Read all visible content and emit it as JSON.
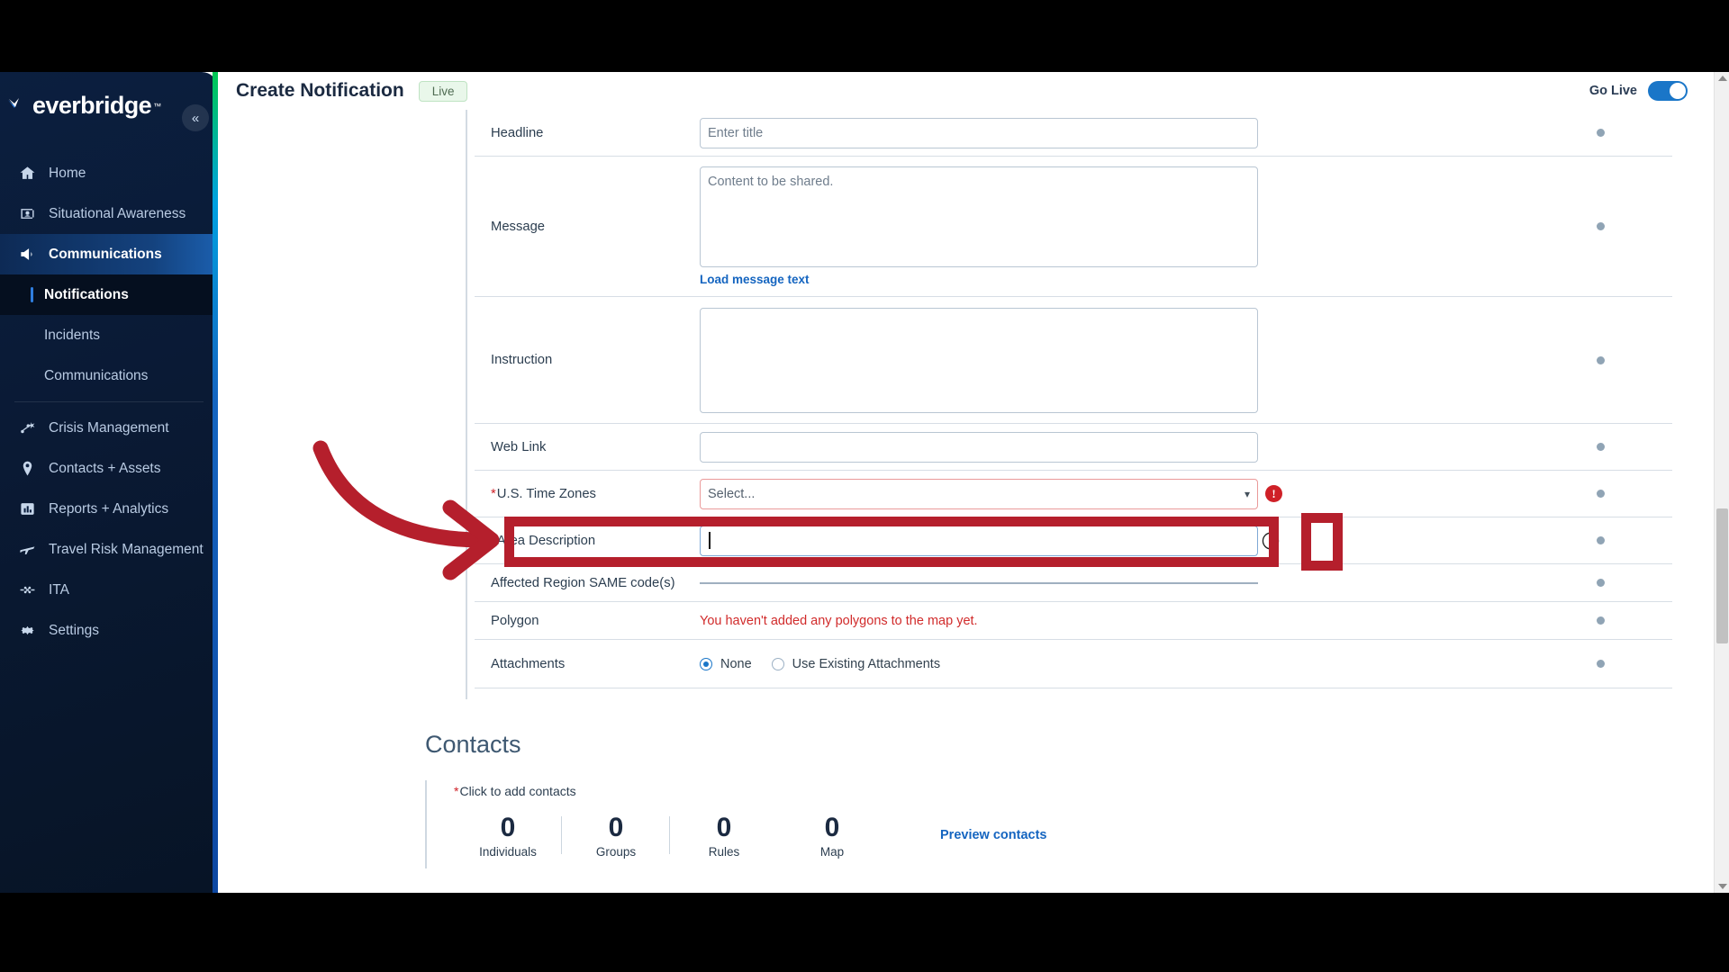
{
  "brand": {
    "name": "everbridge",
    "tm": "™",
    "accent": "#1a76c8"
  },
  "sidebar": {
    "collapse_icon": "chevron-double-left-icon",
    "items": [
      {
        "label": "Home",
        "icon": "home-icon",
        "active": false
      },
      {
        "label": "Situational Awareness",
        "icon": "situational-awareness-icon",
        "active": false
      },
      {
        "label": "Communications",
        "icon": "megaphone-icon",
        "active": true
      }
    ],
    "sub_items": [
      {
        "label": "Notifications",
        "current": true
      },
      {
        "label": "Incidents",
        "current": false
      },
      {
        "label": "Communications",
        "current": false
      }
    ],
    "items_lower": [
      {
        "label": "Crisis Management",
        "icon": "crisis-management-icon"
      },
      {
        "label": "Contacts + Assets",
        "icon": "location-pin-icon"
      },
      {
        "label": "Reports + Analytics",
        "icon": "bar-chart-icon"
      },
      {
        "label": "Travel Risk Management",
        "icon": "airplane-icon"
      },
      {
        "label": "ITA",
        "icon": "ita-icon"
      },
      {
        "label": "Settings",
        "icon": "gear-icon"
      }
    ]
  },
  "header": {
    "title": "Create Notification",
    "badge": "Live",
    "go_live_label": "Go Live",
    "go_live_on": true
  },
  "form": {
    "rows": [
      {
        "label": "Headline",
        "required": false,
        "value": "",
        "placeholder": "Enter title",
        "type": "text"
      },
      {
        "label": "Message",
        "required": false,
        "value": "",
        "placeholder": "Content to be shared.",
        "type": "textarea",
        "helper_link": "Load message text"
      },
      {
        "label": "Instruction",
        "required": false,
        "value": "",
        "placeholder": "",
        "type": "textarea"
      },
      {
        "label": "Web Link",
        "required": false,
        "value": "",
        "placeholder": "",
        "type": "text"
      },
      {
        "label": "U.S. Time Zones",
        "required": true,
        "value": "Select...",
        "type": "select",
        "error": true
      },
      {
        "label": "Area Description",
        "required": true,
        "value": "",
        "placeholder": "",
        "type": "text",
        "focused": true,
        "info_icon": "info-icon"
      },
      {
        "label": "Affected Region SAME code(s)",
        "required": false,
        "value": "",
        "type": "blank-line"
      },
      {
        "label": "Polygon",
        "required": false,
        "value": "You haven't added any polygons to the map yet.",
        "type": "warning"
      },
      {
        "label": "Attachments",
        "required": false,
        "type": "radio"
      }
    ],
    "attachment_options": [
      {
        "label": "None",
        "selected": true
      },
      {
        "label": "Use Existing Attachments",
        "selected": false
      }
    ]
  },
  "contacts": {
    "title": "Contacts",
    "add_hint": "Click to add contacts",
    "stats": [
      {
        "num": "0",
        "cap": "Individuals"
      },
      {
        "num": "0",
        "cap": "Groups"
      },
      {
        "num": "0",
        "cap": "Rules"
      },
      {
        "num": "0",
        "cap": "Map"
      }
    ],
    "preview_link": "Preview contacts"
  },
  "annotations": {
    "color": "#b51f2c",
    "arrow": "curved-right-arrow",
    "highlight_targets": [
      "area-description-row",
      "area-description-info-button"
    ]
  }
}
